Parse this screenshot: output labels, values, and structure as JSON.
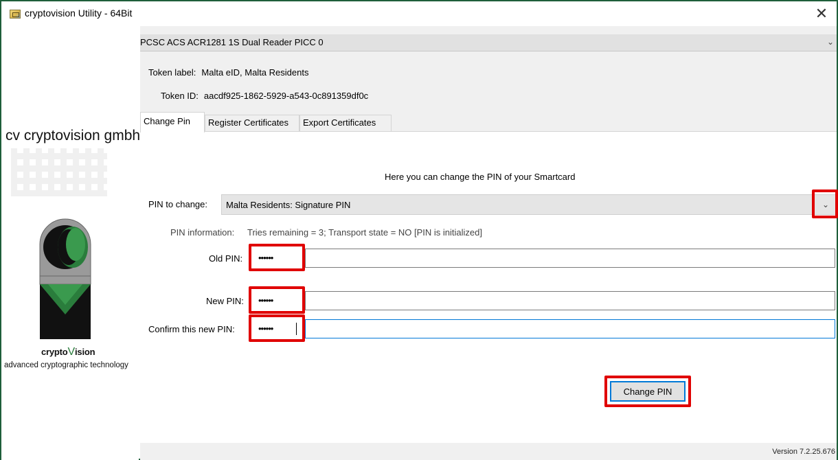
{
  "window": {
    "title": "cryptovision Utility - 64Bit",
    "close_glyph": "✕"
  },
  "brand": {
    "company": "cv cryptovision gmbh",
    "logo_word_a": "crypto",
    "logo_word_v": "V",
    "logo_word_b": "ision",
    "tagline": "advanced cryptographic technology",
    "colors": {
      "green": "#2a7d3c",
      "black": "#111111",
      "gray": "#9a9a9a"
    }
  },
  "reader": {
    "selected": "PCSC ACS ACR1281 1S Dual Reader PICC 0",
    "chevron": "⌄"
  },
  "token": {
    "label_key": "Token label:",
    "label_value": "Malta eID, Malta Residents",
    "id_key": "Token ID:",
    "id_value": "aacdf925-1862-5929-a543-0c891359df0c"
  },
  "tabs": [
    {
      "label": "Change Pin",
      "active": true
    },
    {
      "label": "Register Certificates",
      "active": false
    },
    {
      "label": "Export Certificates",
      "active": false
    }
  ],
  "change_pin": {
    "heading": "Here you can change the PIN of your Smartcard",
    "pin_to_change_label": "PIN to change:",
    "pin_to_change_value": "Malta Residents: Signature PIN",
    "dropdown_glyph": "⌄",
    "pin_info_label": "PIN information:",
    "pin_info_value": "Tries remaining = 3; Transport state = NO [PIN is initialized]",
    "old_pin_label": "Old PIN:",
    "old_pin_value": "••••••",
    "new_pin_label": "New PIN:",
    "new_pin_value": "••••••",
    "confirm_pin_label": "Confirm this new PIN:",
    "confirm_pin_value": "••••••",
    "button_label": "Change PIN"
  },
  "highlight_color": "#e00000",
  "status": {
    "version": "Version 7.2.25.676"
  }
}
